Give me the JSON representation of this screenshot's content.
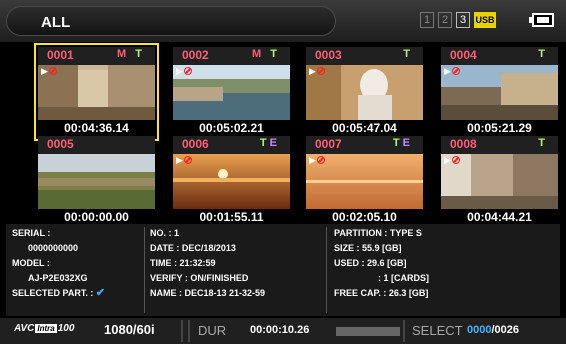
{
  "header": {
    "title": "ALL",
    "slots": [
      "1",
      "2",
      "3"
    ],
    "usb_label": "USB"
  },
  "thumbnails": [
    {
      "clip": "0001",
      "m": "M",
      "t": "T",
      "e": "",
      "timecode": "00:04:36.14"
    },
    {
      "clip": "0002",
      "m": "M",
      "t": "T",
      "e": "",
      "timecode": "00:05:02.21"
    },
    {
      "clip": "0003",
      "m": "",
      "t": "T",
      "e": "",
      "timecode": "00:05:47.04"
    },
    {
      "clip": "0004",
      "m": "",
      "t": "T",
      "e": "",
      "timecode": "00:05:21.29"
    },
    {
      "clip": "0005",
      "m": "",
      "t": "",
      "e": "",
      "timecode": "00:00:00.00"
    },
    {
      "clip": "0006",
      "m": "",
      "t": "T",
      "e": "E",
      "timecode": "00:01:55.11"
    },
    {
      "clip": "0007",
      "m": "",
      "t": "T",
      "e": "E",
      "timecode": "00:02:05.10"
    },
    {
      "clip": "0008",
      "m": "",
      "t": "T",
      "e": "",
      "timecode": "00:04:44.21"
    }
  ],
  "info": {
    "serial_label": "SERIAL :",
    "serial_value": "0000000000",
    "model_label": "MODEL :",
    "model_value": "AJ-P2E032XG",
    "selected_part_label": "SELECTED PART. :",
    "no": "NO. : 1",
    "date": "DATE : DEC/18/2013",
    "time": "TIME : 21:32:59",
    "verify": "VERIFY : ON/FINISHED",
    "name": "NAME : DEC18-13 21-32-59",
    "partition": "PARTITION : TYPE S",
    "size": "SIZE :  55.9 [GB]",
    "used": "USED :  29.6 [GB]",
    "cards": ":  1 [CARDS]",
    "free": "FREE CAP. :  26.3 [GB]"
  },
  "status": {
    "codec_avc": "AVC",
    "codec_intra": "Intra",
    "codec_num": "100",
    "format": "1080/60i",
    "dur_label": "DUR",
    "dur_value": "00:00:10.26",
    "select_label": "SELECT",
    "select_current": "0000",
    "select_total": "/0026"
  },
  "colors": {
    "clip_number": "#ff5e78",
    "selected_border": "#ffe22a",
    "select_count": "#40b4ff"
  }
}
